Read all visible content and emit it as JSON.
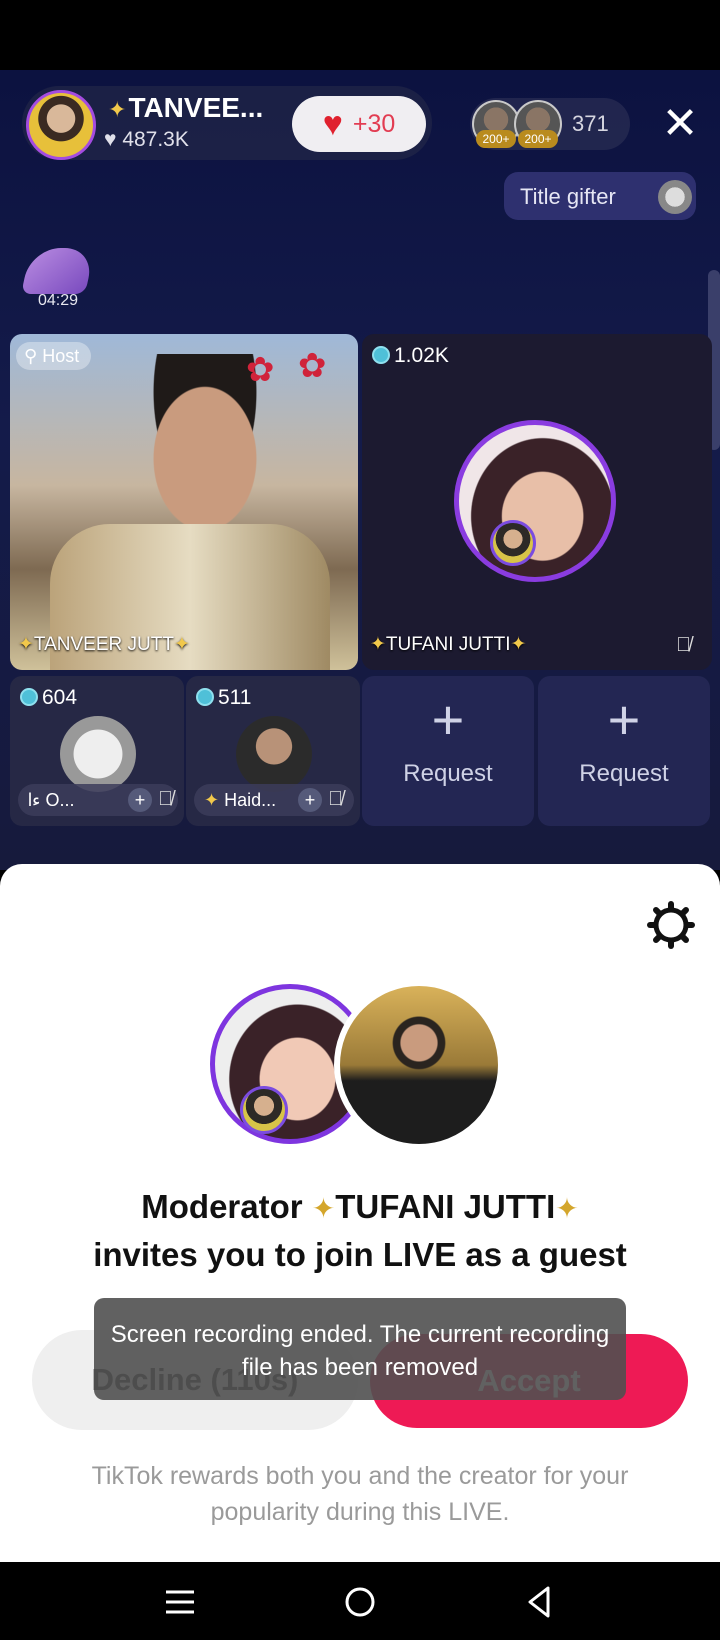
{
  "host": {
    "name": "TANVEE...",
    "likes": "487.3K",
    "like_bonus": "+30",
    "viewer_count": "371",
    "viewer_badges": [
      "200+",
      "200+"
    ]
  },
  "title_gifter": {
    "label": "Title gifter"
  },
  "gift_timer": "04:29",
  "grid": {
    "host_tile": {
      "badge": "Host",
      "name": "TANVEER JUTT"
    },
    "guest_tile": {
      "count": "1.02K",
      "name": "TUFANI JUTTI"
    },
    "small_tiles": [
      {
        "count": "604",
        "name": "l‎ء O..."
      },
      {
        "count": "511",
        "name": "Haid..."
      }
    ],
    "request_tiles": [
      {
        "plus": "+",
        "label": "Request"
      },
      {
        "plus": "+",
        "label": "Request"
      }
    ]
  },
  "invite": {
    "line1_prefix": "Moderator ",
    "moderator": "TUFANI JUTTI",
    "line2": "invites you to join LIVE as a guest",
    "decline_label": "Decline (110s)",
    "accept_label": "Accept",
    "reward_text": "TikTok rewards both you and the creator for your popularity during this LIVE."
  },
  "toast": {
    "message": "Screen recording ended. The current recording file has been removed"
  },
  "colors": {
    "accent": "#ee1a55",
    "ring": "#7e35df",
    "live_bg": "#141b4a"
  },
  "icons": [
    "heart-icon",
    "close-icon",
    "gear-icon",
    "mic-off-icon",
    "menu-icon",
    "home-icon",
    "back-icon"
  ]
}
